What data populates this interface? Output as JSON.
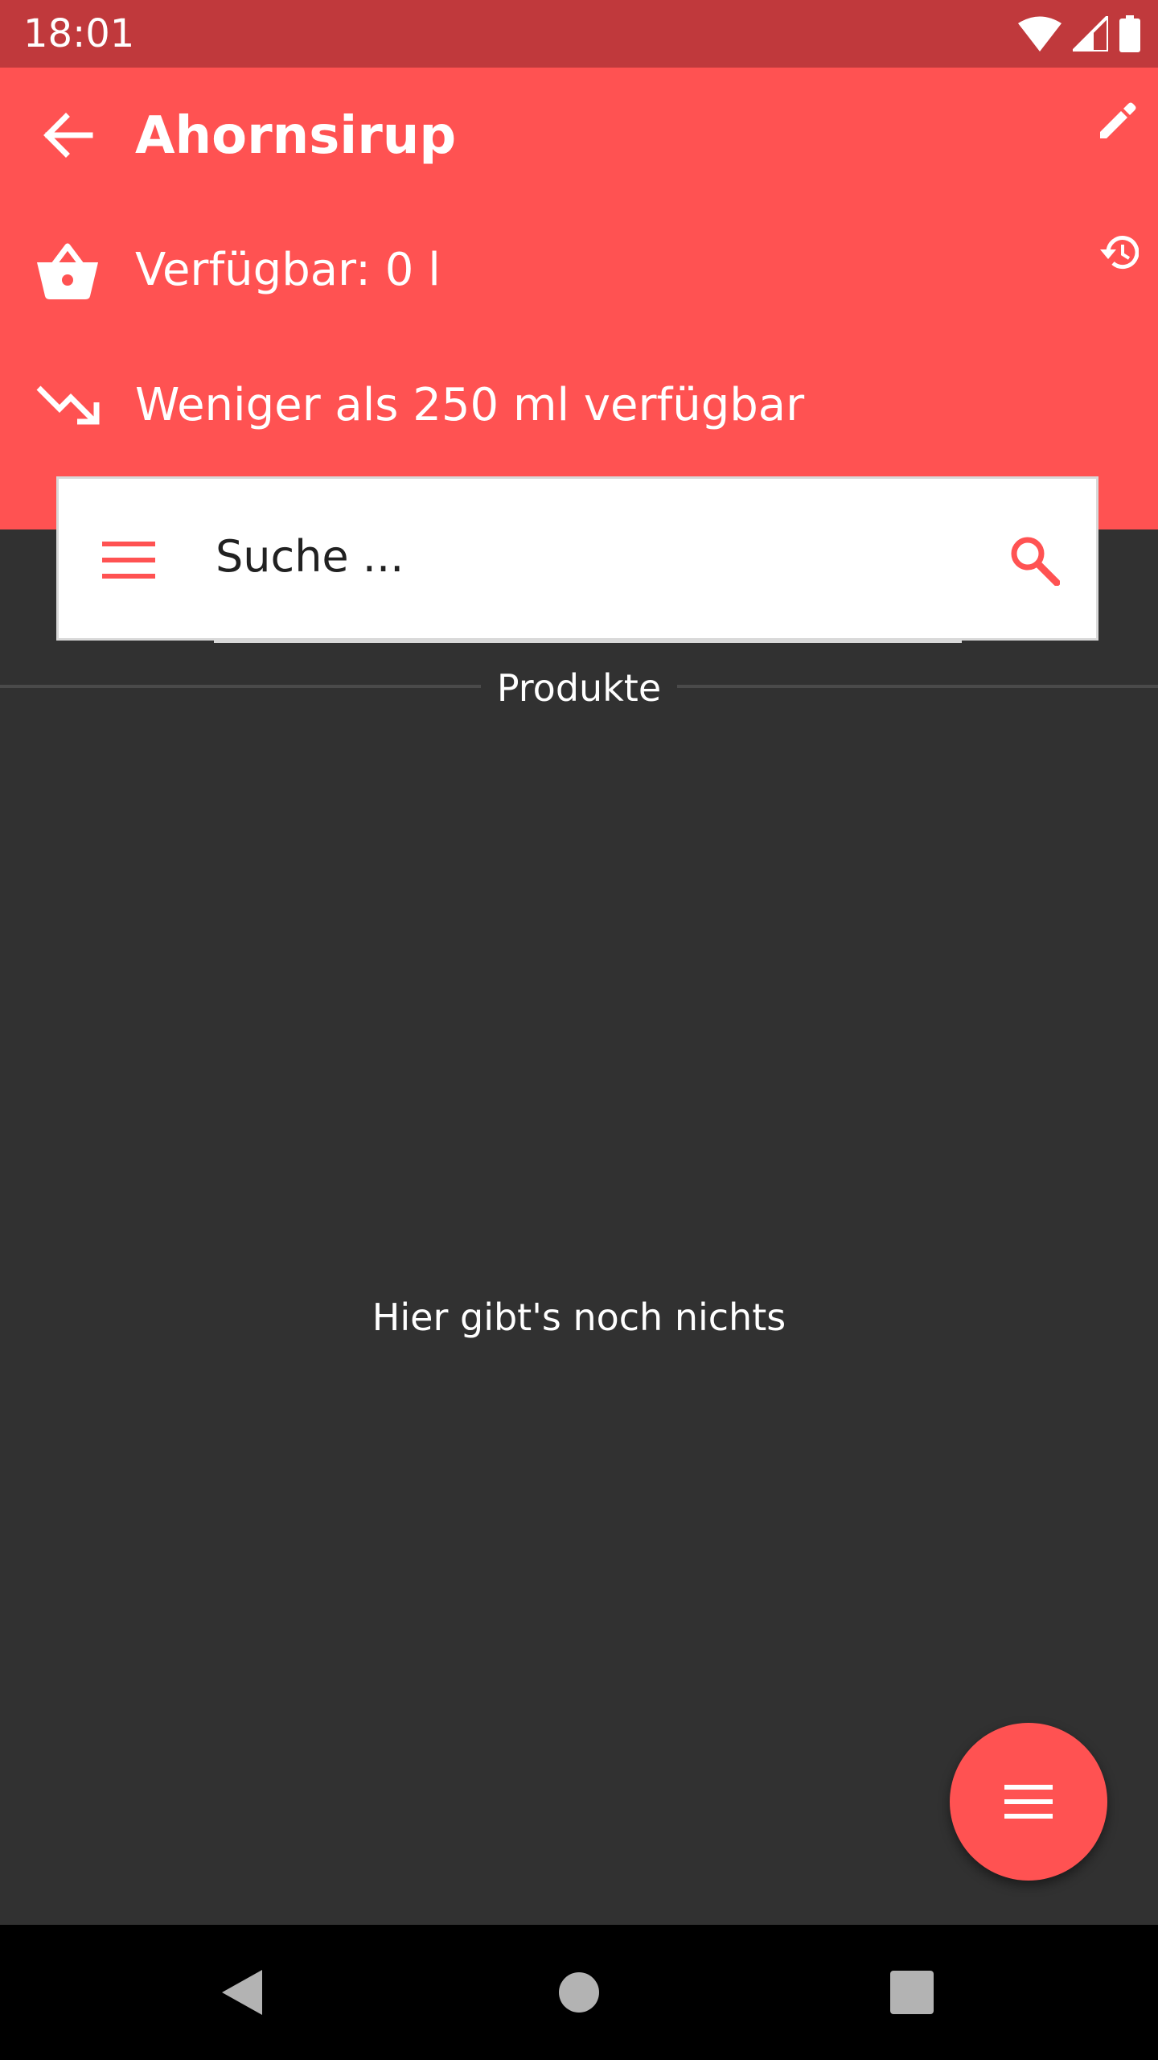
{
  "status_bar": {
    "time": "18:01",
    "icons": [
      "wifi-icon",
      "signal-icon",
      "battery-icon"
    ]
  },
  "header": {
    "back_icon": "arrow-left-icon",
    "title": "Ahornsirup",
    "edit_icon": "pencil-icon",
    "history_icon": "history-icon",
    "available": {
      "icon": "basket-icon",
      "text": "Verfügbar: 0 l"
    },
    "threshold": {
      "icon": "trending-down-icon",
      "text": "Weniger als 250 ml verfügbar"
    }
  },
  "search": {
    "menu_icon": "hamburger-menu-icon",
    "placeholder": "Suche ...",
    "search_icon": "search-icon"
  },
  "tab": {
    "label": "Produkte"
  },
  "content": {
    "empty_message": "Hier gibt's noch nichts"
  },
  "fab": {
    "icon": "menu-icon"
  },
  "nav_bar": {
    "buttons": [
      "back-triangle-icon",
      "home-circle-icon",
      "recents-square-icon"
    ]
  },
  "colors": {
    "accent": "#ff5252",
    "status_bar": "#c0393c",
    "background": "#313131",
    "nav_bar": "#000000"
  }
}
